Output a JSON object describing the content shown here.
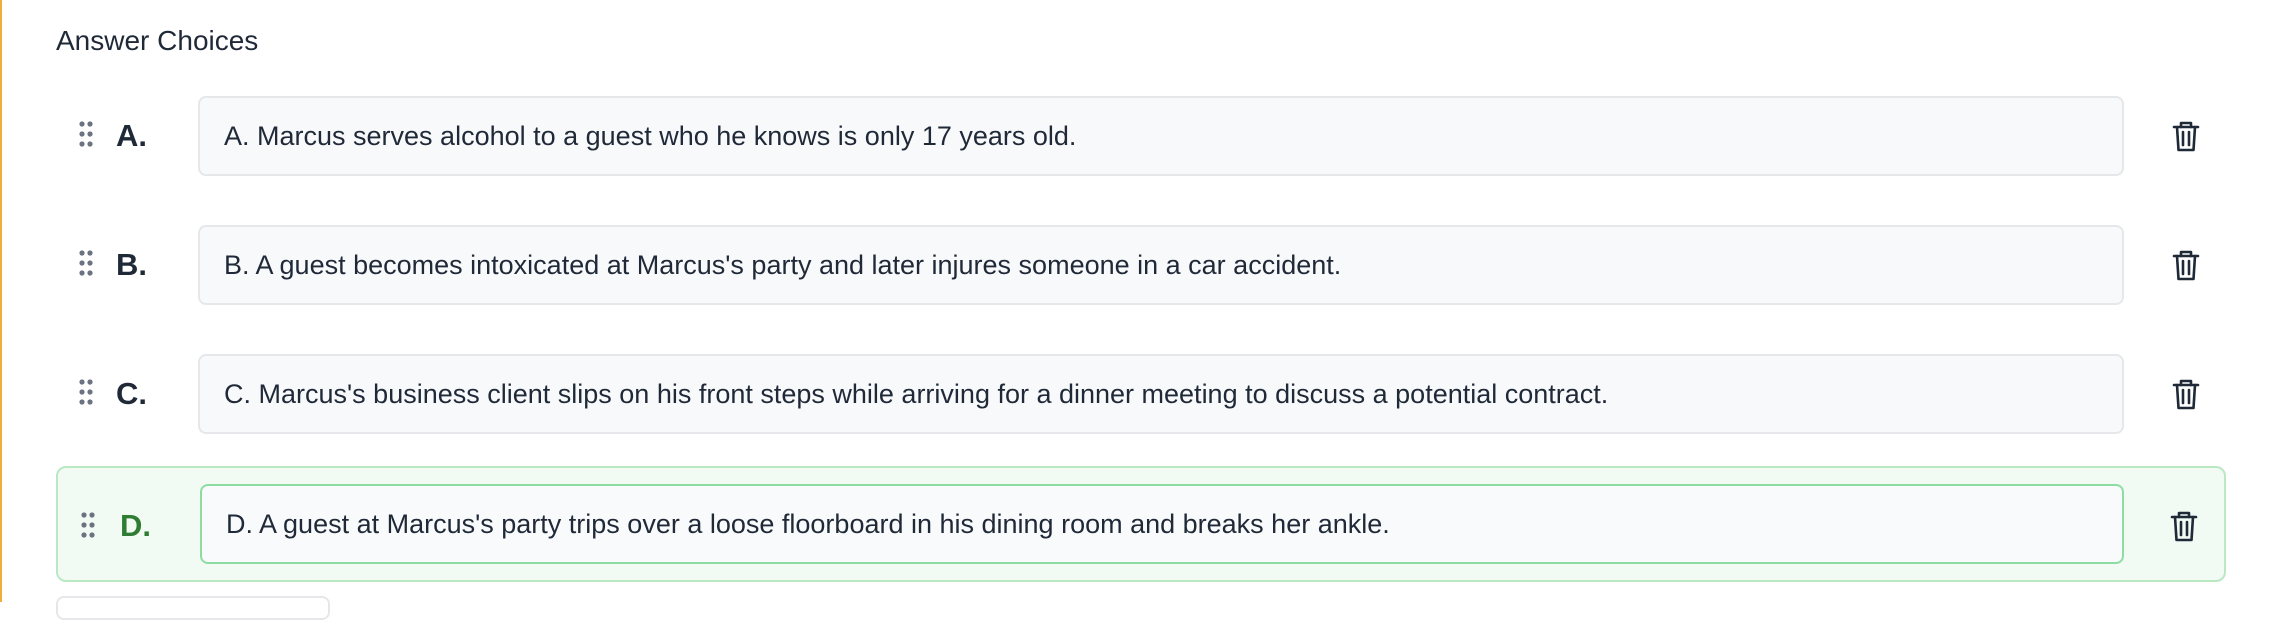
{
  "section": {
    "title": "Answer Choices"
  },
  "choices": [
    {
      "letter": "A.",
      "text": "A. Marcus serves alcohol to a guest who he knows is only 17 years old.",
      "selected": false
    },
    {
      "letter": "B.",
      "text": "B. A guest becomes intoxicated at Marcus's party and later injures someone in a car accident.",
      "selected": false
    },
    {
      "letter": "C.",
      "text": "C. Marcus's business client slips on his front steps while arriving for a dinner meeting to discuss a potential contract.",
      "selected": false
    },
    {
      "letter": "D.",
      "text": "D. A guest at Marcus's party trips over a loose floorboard in his dining room and breaks her ankle.",
      "selected": true
    }
  ],
  "icons": {
    "drag": "drag-handle-icon",
    "delete": "trash-icon"
  },
  "colors": {
    "accent_border": "#f0ad3c",
    "selected_bg": "#f1fbf3",
    "selected_border": "#b9e8c3",
    "selected_letter": "#2e7d32"
  }
}
